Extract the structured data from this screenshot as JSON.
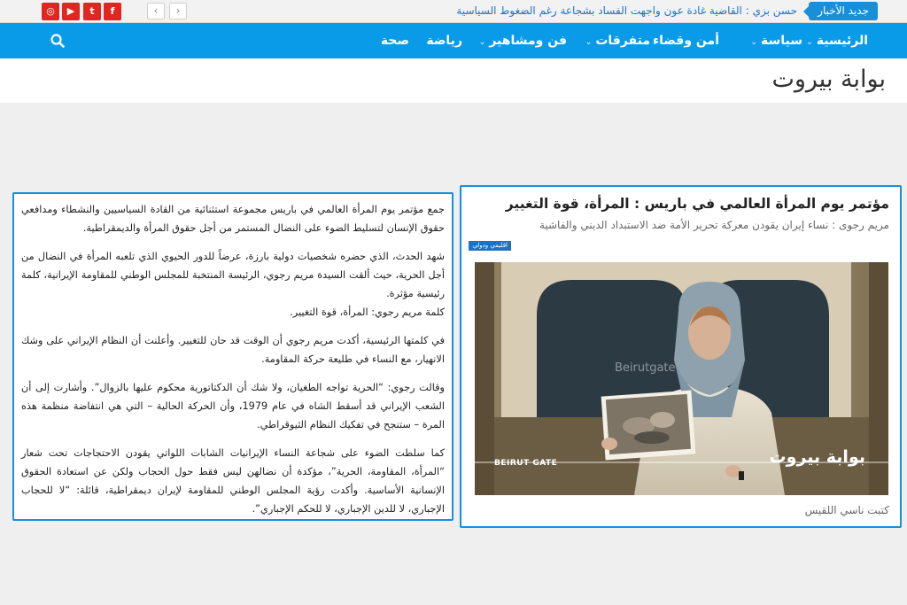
{
  "topbar": {
    "news_label": "جديد الأخبار",
    "ticker": "حسن بزي : القاضية غادة عون واجهت الفساد بشجاعة رغم الضغوط السياسية",
    "prev_arrow": "‹",
    "next_arrow": "›",
    "social": [
      {
        "name": "facebook-icon",
        "glyph": "f",
        "color": "#e0261e"
      },
      {
        "name": "twitter-icon",
        "glyph": "t",
        "color": "#e0261e"
      },
      {
        "name": "youtube-icon",
        "glyph": "▶",
        "color": "#e0261e"
      },
      {
        "name": "instagram-icon",
        "glyph": "◎",
        "color": "#e0261e"
      }
    ]
  },
  "nav": {
    "items": [
      {
        "label": "الرئيسية",
        "dropdown": true
      },
      {
        "label": "سياسة",
        "dropdown": true
      },
      {
        "label": "أمن وقضاء",
        "dropdown": false
      },
      {
        "label": "متفرقات",
        "dropdown": true
      },
      {
        "label": "فن ومشاهير",
        "dropdown": true
      },
      {
        "label": "رياضة",
        "dropdown": false
      },
      {
        "label": "صحة",
        "dropdown": false
      }
    ],
    "chevron": "⌄",
    "accent": "#0a9be8"
  },
  "site": {
    "title": "بوابة بيروت"
  },
  "article": {
    "title": "مؤتمر يوم المرأة العالمي في باريس : المرأة، قوة التغيير",
    "subtitle": "مريم رجوى : نساء إيران يقودن معركة تحرير الأمة ضد الاستبداد الديني والفاشية",
    "category": "اقليمي ودولي",
    "author": "كتبت ناسي اللقيس",
    "photo": {
      "watermark": "Beirutgate",
      "logo_ar": "بوابة بيروت",
      "logo_en": "BEIRUT GATE"
    }
  },
  "body": {
    "paragraphs": [
      "جمع مؤتمر يوم المرأة العالمي في باريس مجموعة استثنائية من القادة السياسيين والنشطاء ومدافعي حقوق الإنسان لتسليط الضوء على النضال المستمر من أجل حقوق المرأة والديمقراطية.",
      "شهد الحدث، الذي حضره شخصيات دولية بارزة، عرضاً للدور الحيوي الذي تلعبه المرأة في النضال من أجل الحرية، حيث ألقت السيدة مريم رجوي، الرئيسة المنتخبة للمجلس الوطني للمقاومة الإيرانية، كلمة رئيسية مؤثرة.",
      "كلمة مريم رجوي: المرأة، قوة التغيير.",
      "في كلمتها الرئيسية، أكدت مريم رجوي أن الوقت قد حان للتغيير. وأعلنت أن النظام الإيراني على وشك الانهيار، مع النساء في طليعة حركة المقاومة.",
      "وقالت رجوي: “الحرية تواجه الطغيان، ولا شك أن الدكتاتورية محكوم عليها بالزوال”. وأشارت إلى أن الشعب الإيراني قد أسقط الشاه في عام 1979، وأن الحركة الحالية – التي هي انتفاضة منظمة هذه المرة – ستنجح في تفكيك النظام الثيوقراطي.",
      "كما سلطت الضوء على شجاعة النساء الإيرانيات الشابات اللواتي يقودن الاحتجاجات تحت شعار “المرأة، المقاومة، الحرية”، مؤكدة أن نضالهن ليس فقط حول الحجاب ولكن عن استعادة الحقوق الإنسانية الأساسية. وأكدت رؤية المجلس الوطني للمقاومة لإيران ديمقراطية، قائلة: “لا للحجاب الإجباري، لا للدين الإجباري، لا للحكم الإجباري”."
    ]
  }
}
